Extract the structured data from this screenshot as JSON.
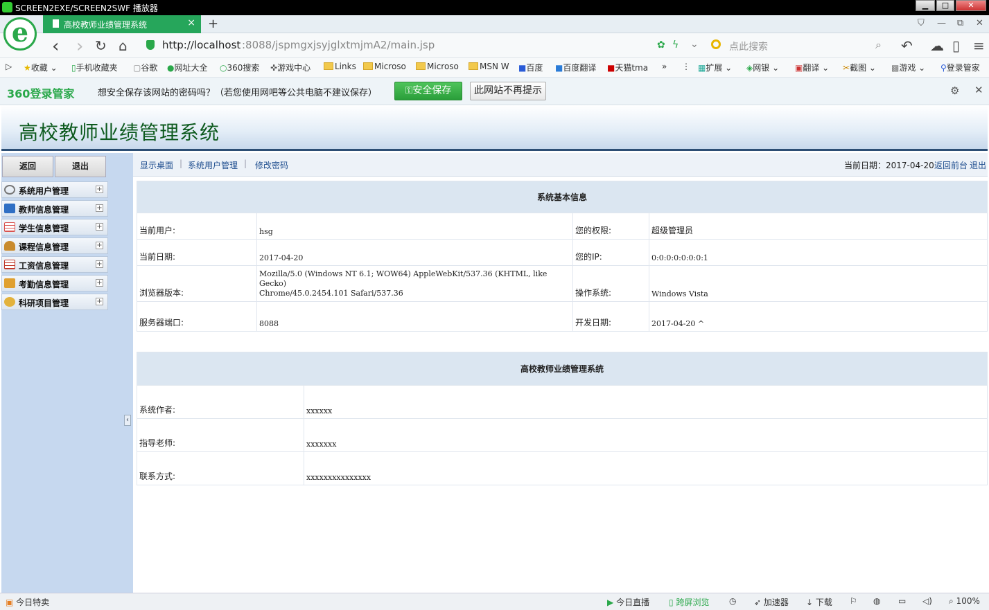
{
  "window": {
    "title": "SCREEN2EXE/SCREEN2SWF 播放器",
    "min": "▁",
    "max": "□",
    "close": "✕"
  },
  "tab": {
    "title": "高校教师业绩管理系统",
    "close": "×",
    "new": "+"
  },
  "tab_icons": {
    "shirt": "⛉",
    "minimize": "—",
    "restore": "⧉",
    "close": "✕"
  },
  "nav": {
    "back": "‹",
    "forward": "›",
    "reload": "↻",
    "home": "⌂",
    "url_host": "http://localhost",
    "url_rest": ":8088/jspmgxjsyjglxtmjmA2/main.jsp",
    "search_placeholder": "点此搜索",
    "undo": "↶",
    "cloud": "☁",
    "phone": "▯",
    "menu": "≡"
  },
  "bookmarks": [
    "收藏",
    "手机收藏夹",
    "谷歌",
    "网址大全",
    "360搜索",
    "游戏中心",
    "Links",
    "Microso",
    "Microso",
    "MSN W",
    "百度",
    "百度翻译",
    "天猫tma"
  ],
  "bookmark_more": "»",
  "toolbar_ext": [
    "扩展",
    "网银",
    "翻译",
    "截图",
    "游戏",
    "登录管家"
  ],
  "password_bar": {
    "brand": "360登录管家",
    "message": "想安全保存该网站的密码吗？（若您使用网吧等公共电脑不建议保存）",
    "save": "安全保存",
    "never": "此网站不再提示",
    "gear": "⚙",
    "close": "✕"
  },
  "app": {
    "title": "高校教师业绩管理系统",
    "sidebar_buttons": {
      "back": "返回",
      "logout": "退出"
    },
    "menu": [
      {
        "label": "系统用户管理",
        "icon_color": "#8a8a8a"
      },
      {
        "label": "教师信息管理",
        "icon_color": "#2f6fc4"
      },
      {
        "label": "学生信息管理",
        "icon_color": "#d9534f"
      },
      {
        "label": "课程信息管理",
        "icon_color": "#c98b2e"
      },
      {
        "label": "工资信息管理",
        "icon_color": "#c0392b"
      },
      {
        "label": "考勤信息管理",
        "icon_color": "#e0a030"
      },
      {
        "label": "科研项目管理",
        "icon_color": "#e3b23c"
      }
    ],
    "crumbs": [
      "显示桌面",
      "系统用户管理",
      "修改密码"
    ],
    "current_date_label": "当前日期：2017-04-20",
    "links": {
      "front": "返回前台",
      "logout": "退出"
    },
    "info_title": "系统基本信息",
    "info_rows": [
      {
        "l1": "当前用户:",
        "v1": "hsg",
        "l2": "您的权限:",
        "v2": "超级管理员"
      },
      {
        "l1": "当前日期:",
        "v1": "2017-04-20",
        "l2": "您的IP:",
        "v2": "0:0:0:0:0:0:0:1"
      },
      {
        "l1": "浏览器版本:",
        "v1a": "Mozilla/5.0 (Windows NT 6.1; WOW64) AppleWebKit/537.36 (KHTML, like Gecko)",
        "v1b": "Chrome/45.0.2454.101 Safari/537.36",
        "l2": "操作系统:",
        "v2": "Windows Vista"
      },
      {
        "l1": "服务器端口:",
        "v1": "8088",
        "l2": "开发日期:",
        "v2": "2017-04-20 ^"
      }
    ],
    "about_title": "高校教师业绩管理系统",
    "about_rows": [
      {
        "label": "系统作者:",
        "value": "xxxxxx"
      },
      {
        "label": "指导老师:",
        "value": "xxxxxxx"
      },
      {
        "label": "联系方式:",
        "value": "xxxxxxxxxxxxxxx"
      }
    ]
  },
  "status": {
    "left": "今日特卖",
    "items": [
      "今日直播",
      "跨屏浏览",
      "加速器",
      "下载"
    ],
    "zoom": "100%"
  }
}
